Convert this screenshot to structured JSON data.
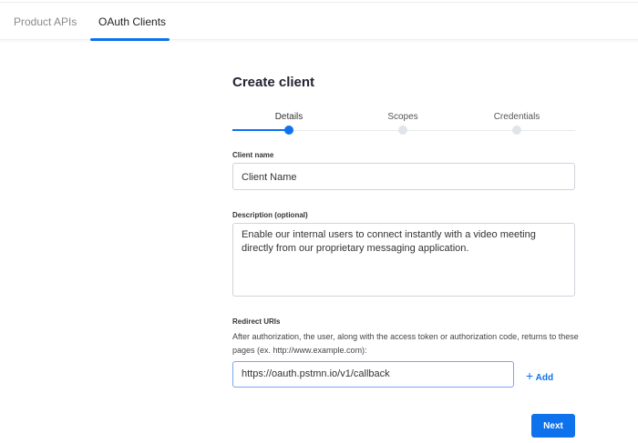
{
  "tabs": [
    {
      "label": "Product APIs"
    },
    {
      "label": "OAuth Clients"
    }
  ],
  "title": "Create client",
  "steps": [
    {
      "label": "Details"
    },
    {
      "label": "Scopes"
    },
    {
      "label": "Credentials"
    }
  ],
  "client_name": {
    "label": "Client name",
    "value": "Client Name"
  },
  "description": {
    "label": "Description (optional)",
    "value": "Enable our internal users to connect instantly with a video meeting directly from our proprietary messaging application."
  },
  "redirect": {
    "label": "Redirect URIs",
    "help": "After authorization, the user, along with the access token or authorization code, returns to these pages (ex. http://www.example.com):",
    "value": "https://oauth.pstmn.io/v1/callback",
    "add_label": "Add"
  },
  "next_label": "Next",
  "accent": "#0e72ed"
}
